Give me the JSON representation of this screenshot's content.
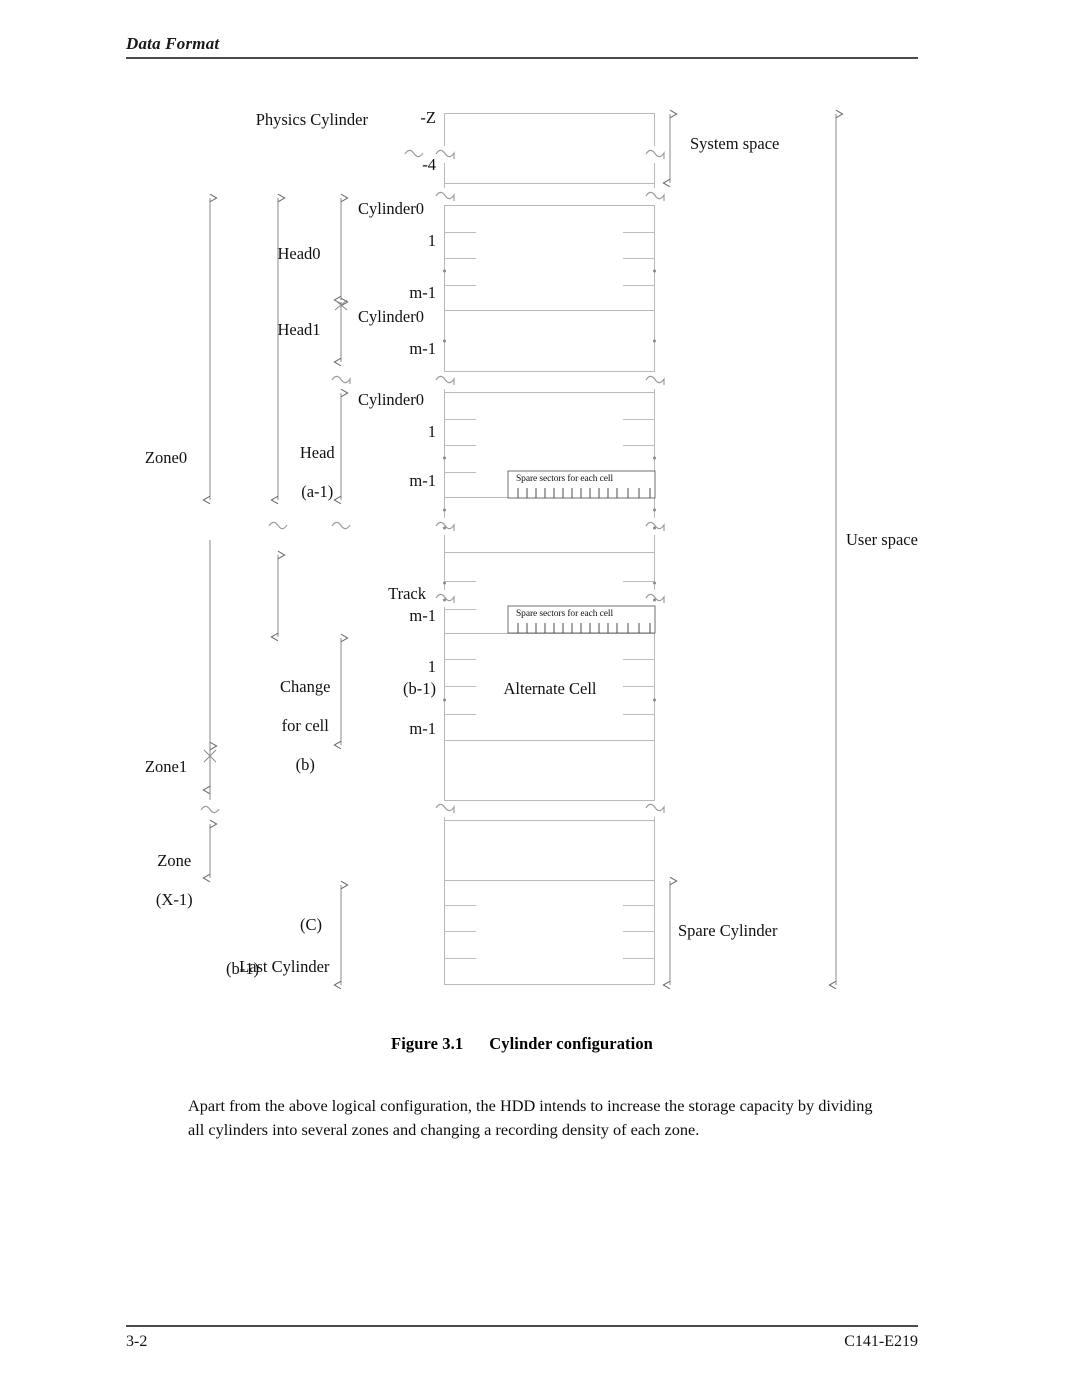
{
  "header": {
    "title": "Data Format"
  },
  "footer": {
    "page_number": "3-2",
    "doc_number": "C141-E219"
  },
  "caption": {
    "number": "Figure 3.1",
    "text": "Cylinder configuration"
  },
  "body": {
    "paragraph": "Apart from the above logical configuration, the HDD intends to increase the storage capacity by dividing all cylinders into several zones and changing a recording density of each zone."
  },
  "figure": {
    "title": "Cylinder configuration",
    "left_labels": {
      "physics_cylinder": "Physics Cylinder",
      "zone0": "Zone0",
      "zone1": "Zone1",
      "zone_x1_line1": "Zone",
      "zone_x1_line2": "(X-1)",
      "head0": "Head0",
      "head1": "Head1",
      "head_a1_line1": "Head",
      "head_a1_line2": "(a-1)",
      "change_for_cell_line1": "Change",
      "change_for_cell_line2": "for cell",
      "change_for_cell_line3": "(b)",
      "last_cylinder_c": "(C)",
      "last_cylinder_line1": "Last Cylinder",
      "last_cylinder_line2": "(b-1)"
    },
    "row_labels": {
      "minus_z": "-Z",
      "minus_4": "-4",
      "cylinder0_a": "Cylinder0",
      "one_a": "1",
      "m_minus_1_a": "m-1",
      "cylinder0_b": "Cylinder0",
      "m_minus_1_b": "m-1",
      "cylinder0_c": "Cylinder0",
      "one_b": "1",
      "m_minus_1_c": "m-1",
      "track": "Track",
      "m_minus_1_d": "m-1",
      "one_c": "1",
      "b_minus_1": "(b-1)",
      "m_minus_1_e": "m-1"
    },
    "inner_labels": {
      "spare_sectors_1": "Spare sectors for each cell",
      "spare_sectors_2": "Spare sectors for each cell",
      "alternate_cell": "Alternate Cell"
    },
    "right_labels": {
      "system_space": "System space",
      "user_space": "User space",
      "spare_cylinder": "Spare Cylinder"
    }
  }
}
